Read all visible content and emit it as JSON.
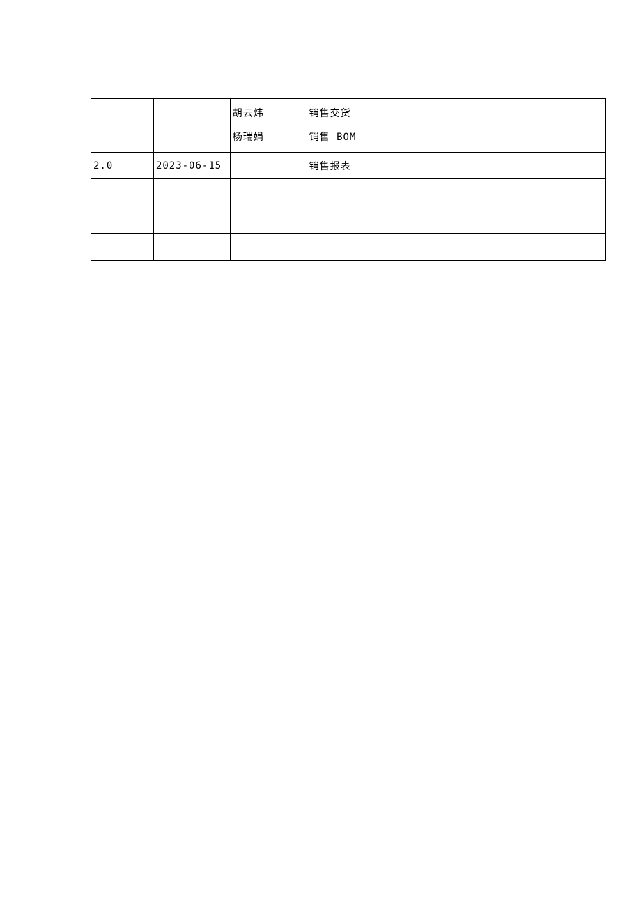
{
  "table": {
    "rows": [
      {
        "col1": "",
        "col2": "",
        "col3_line1": "胡云炜",
        "col3_line2": "杨瑞娟",
        "col4_line1": "销售交货",
        "col4_line2": "销售 BOM"
      },
      {
        "col1": "2.0",
        "col2": "2023-06-15",
        "col3": "",
        "col4": "销售报表"
      },
      {
        "col1": "",
        "col2": "",
        "col3": "",
        "col4": ""
      },
      {
        "col1": "",
        "col2": "",
        "col3": "",
        "col4": ""
      },
      {
        "col1": "",
        "col2": "",
        "col3": "",
        "col4": ""
      }
    ]
  }
}
